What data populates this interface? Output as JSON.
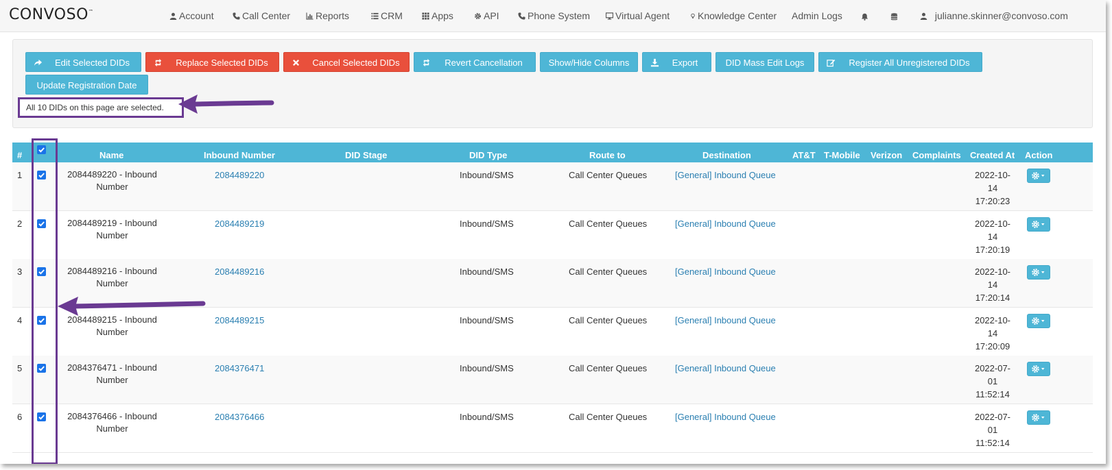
{
  "brand": {
    "logo_text": "CONVOSO",
    "trademark": "™"
  },
  "nav": {
    "items": [
      {
        "label": "Account",
        "icon": "user-icon"
      },
      {
        "label": "Call Center",
        "icon": "phone-icon"
      },
      {
        "label": "Reports",
        "icon": "bar-chart-icon"
      },
      {
        "label": "CRM",
        "icon": "list-icon"
      },
      {
        "label": "Apps",
        "icon": "grid-icon"
      },
      {
        "label": "API",
        "icon": "gear-icon"
      },
      {
        "label": "Phone System",
        "icon": "phone-icon"
      },
      {
        "label": "Virtual Agent",
        "icon": "monitor-icon"
      },
      {
        "label": "Knowledge Center",
        "icon": "lightbulb-icon"
      },
      {
        "label": "Admin Logs",
        "icon": ""
      }
    ],
    "bell_icon": "bell-icon",
    "database_icon": "database-icon",
    "user_email": "julianne.skinner@convoso.com"
  },
  "actions": {
    "edit_selected": "Edit Selected DIDs",
    "replace_selected": "Replace Selected DIDs",
    "cancel_selected": "Cancel Selected DIDs",
    "revert_cancellation": "Revert Cancellation",
    "show_hide_columns": "Show/Hide Columns",
    "export": "Export",
    "mass_edit_logs": "DID Mass Edit Logs",
    "register_all": "Register All Unregistered DIDs",
    "update_registration": "Update Registration Date",
    "selection_note": "All 10 DIDs on this page are selected."
  },
  "colors": {
    "primary": "#4eb6d6",
    "danger": "#e9503c",
    "link": "#2a7fb1",
    "highlight": "#6a3a92",
    "checkbox": "#1a73e8"
  },
  "table": {
    "headers": {
      "index": "#",
      "name": "Name",
      "inbound_number": "Inbound Number",
      "did_stage": "DID Stage",
      "did_type": "DID Type",
      "route_to": "Route to",
      "destination": "Destination",
      "att": "AT&T",
      "tmobile": "T-Mobile",
      "verizon": "Verizon",
      "complaints": "Complaints",
      "created_at": "Created At",
      "action": "Action"
    },
    "rows": [
      {
        "index": "1",
        "name_1": "2084489220 - Inbound",
        "name_2": "Number",
        "number": "2084489220",
        "stage": "",
        "type": "Inbound/SMS",
        "route": "Call Center Queues",
        "destination": "[General] Inbound Queue",
        "date_1": "2022-10-",
        "date_2": "14",
        "date_3": "17:20:23"
      },
      {
        "index": "2",
        "name_1": "2084489219 - Inbound",
        "name_2": "Number",
        "number": "2084489219",
        "stage": "",
        "type": "Inbound/SMS",
        "route": "Call Center Queues",
        "destination": "[General] Inbound Queue",
        "date_1": "2022-10-",
        "date_2": "14",
        "date_3": "17:20:19"
      },
      {
        "index": "3",
        "name_1": "2084489216 - Inbound",
        "name_2": "Number",
        "number": "2084489216",
        "stage": "",
        "type": "Inbound/SMS",
        "route": "Call Center Queues",
        "destination": "[General] Inbound Queue",
        "date_1": "2022-10-",
        "date_2": "14",
        "date_3": "17:20:14"
      },
      {
        "index": "4",
        "name_1": "2084489215 - Inbound",
        "name_2": "Number",
        "number": "2084489215",
        "stage": "",
        "type": "Inbound/SMS",
        "route": "Call Center Queues",
        "destination": "[General] Inbound Queue",
        "date_1": "2022-10-",
        "date_2": "14",
        "date_3": "17:20:09"
      },
      {
        "index": "5",
        "name_1": "2084376471 - Inbound",
        "name_2": "Number",
        "number": "2084376471",
        "stage": "",
        "type": "Inbound/SMS",
        "route": "Call Center Queues",
        "destination": "[General] Inbound Queue",
        "date_1": "2022-07-",
        "date_2": "01",
        "date_3": "11:52:14"
      },
      {
        "index": "6",
        "name_1": "2084376466 - Inbound",
        "name_2": "Number",
        "number": "2084376466",
        "stage": "",
        "type": "Inbound/SMS",
        "route": "Call Center Queues",
        "destination": "[General] Inbound Queue",
        "date_1": "2022-07-",
        "date_2": "01",
        "date_3": "11:52:14"
      }
    ]
  }
}
